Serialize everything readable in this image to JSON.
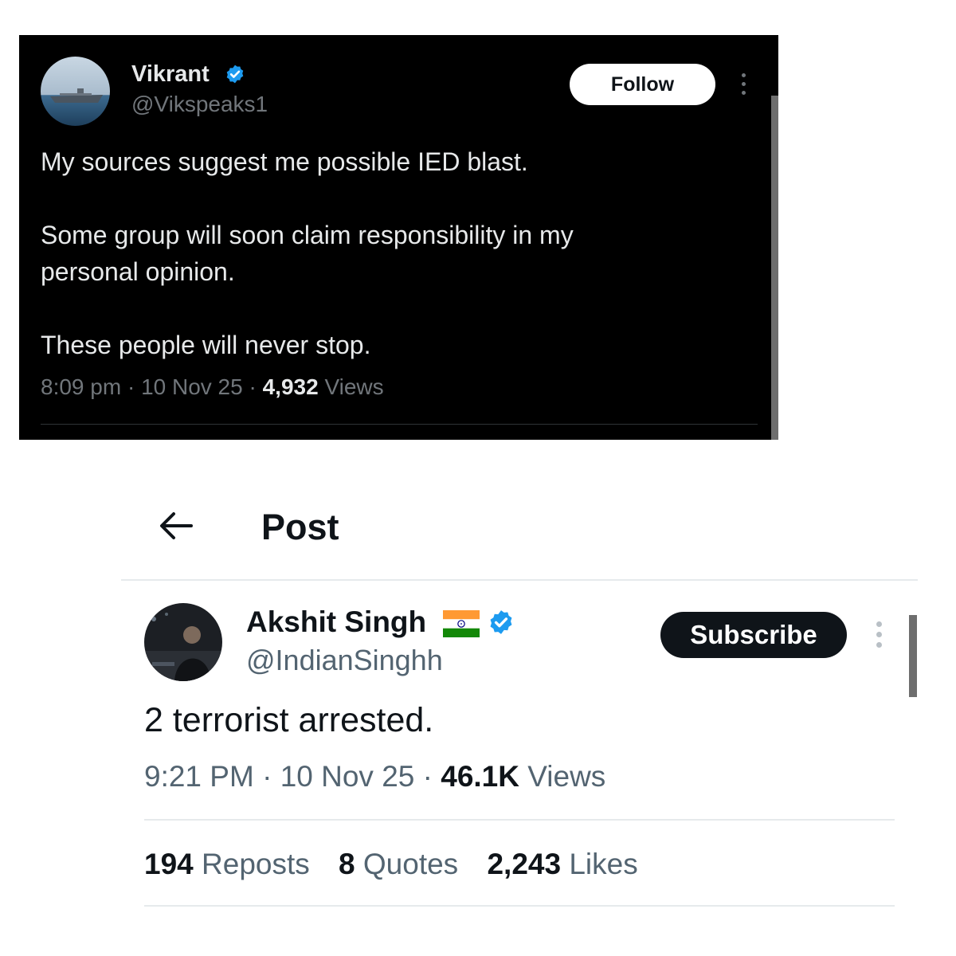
{
  "dark_tweet": {
    "author_name": "Vikrant",
    "author_handle": "@Vikspeaks1",
    "follow_label": "Follow",
    "text_lines": [
      "My sources suggest me possible IED blast.",
      "Some group will soon claim responsibility in my",
      "personal opinion.",
      "These people will never stop."
    ],
    "time": "8:09 pm",
    "date": "10 Nov 25",
    "views_count": "4,932",
    "views_label": "Views",
    "separator": " · "
  },
  "post_page": {
    "header_title": "Post",
    "author_name": "Akshit Singh",
    "author_handle": "@IndianSinghh",
    "subscribe_label": "Subscribe",
    "text": "2 terrorist arrested.",
    "time": "9:21 PM",
    "date": "10 Nov 25",
    "views_count": "46.1K",
    "views_label": "Views",
    "separator": " · ",
    "stats": {
      "reposts_count": "194",
      "reposts_label": "Reposts",
      "quotes_count": "8",
      "quotes_label": "Quotes",
      "likes_count": "2,243",
      "likes_label": "Likes"
    }
  },
  "icons": {
    "verified": "verified-badge-icon",
    "flag": "india-flag-icon",
    "back": "arrow-left-icon",
    "more": "more-vertical-icon"
  },
  "colors": {
    "verified_blue": "#1d9bf0",
    "dark_bg": "#000000",
    "muted_text": "#536471",
    "subscribe_bg": "#0f1419"
  }
}
